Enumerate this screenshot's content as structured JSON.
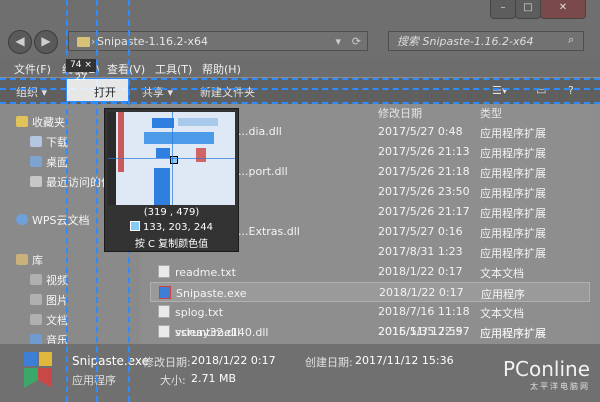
{
  "window": {
    "address_path": "Snipaste-1.16.2-x64",
    "search_placeholder": "搜索 Snipaste-1.16.2-x64"
  },
  "menu": [
    "文件(F)",
    "编辑(E)",
    "查看(V)",
    "工具(T)",
    "帮助(H)"
  ],
  "toolbar": [
    "组织 ▾",
    "打开",
    "共享 ▾",
    "新建文件夹"
  ],
  "sidebar": [
    {
      "label": "收藏夹",
      "icon": "star-icon"
    },
    {
      "label": "下载",
      "icon": "folder-icon"
    },
    {
      "label": "桌面",
      "icon": "folder-icon"
    },
    {
      "label": "最近访问的位置",
      "icon": "folder-icon"
    },
    {
      "label": "WPS云文档",
      "icon": "cloud-icon"
    },
    {
      "label": "库",
      "icon": "library-icon"
    },
    {
      "label": "视频",
      "icon": "folder-icon"
    },
    {
      "label": "图片",
      "icon": "folder-icon"
    },
    {
      "label": "文档",
      "icon": "folder-icon"
    },
    {
      "label": "音乐",
      "icon": "music-icon"
    }
  ],
  "columns": {
    "date": "修改日期",
    "type": "类型"
  },
  "files": [
    {
      "name": "...dia.dll",
      "date": "2017/5/27 0:48",
      "type": "应用程序扩展"
    },
    {
      "name": "",
      "date": "2017/5/26 21:13",
      "type": "应用程序扩展"
    },
    {
      "name": "...port.dll",
      "date": "2017/5/26 21:18",
      "type": "应用程序扩展"
    },
    {
      "name": "",
      "date": "2017/5/26 23:50",
      "type": "应用程序扩展"
    },
    {
      "name": "",
      "date": "2017/5/26 21:17",
      "type": "应用程序扩展"
    },
    {
      "name": "...Extras.dll",
      "date": "2017/5/27 0:16",
      "type": "应用程序扩展"
    },
    {
      "name": "",
      "date": "2017/8/31 1:23",
      "type": "应用程序扩展"
    },
    {
      "name": "readme.txt",
      "date": "2018/1/22 0:17",
      "type": "文本文档"
    },
    {
      "name": "Snipaste.exe",
      "date": "2018/1/22 0:17",
      "type": "应用程序"
    },
    {
      "name": "splog.txt",
      "date": "2018/7/16 11:18",
      "type": "文本文档"
    },
    {
      "name": "ssleay32.dll",
      "date": "2016/5/3 17:59",
      "type": "应用程序扩展"
    },
    {
      "name": "vcruntime140.dll",
      "date": "2015/11/5 22:57",
      "type": "应用程序扩展"
    }
  ],
  "details": {
    "name": "Snipaste.exe",
    "kind": "应用程序",
    "modified_label": "修改日期:",
    "modified": "2018/1/22 0:17",
    "created_label": "创建日期:",
    "created": "2017/11/12 15:36",
    "size_label": "大小:",
    "size": "2.71 MB"
  },
  "snipaste": {
    "size_readout": "74 × 27",
    "coords": "(319 , 479)",
    "rgb": "133, 203, 244",
    "swatch_color": "#85cbf4",
    "copy_hint": "按 C 复制颜色值"
  },
  "watermark": {
    "brand": "PConline",
    "sub": "太平洋电脑网"
  }
}
